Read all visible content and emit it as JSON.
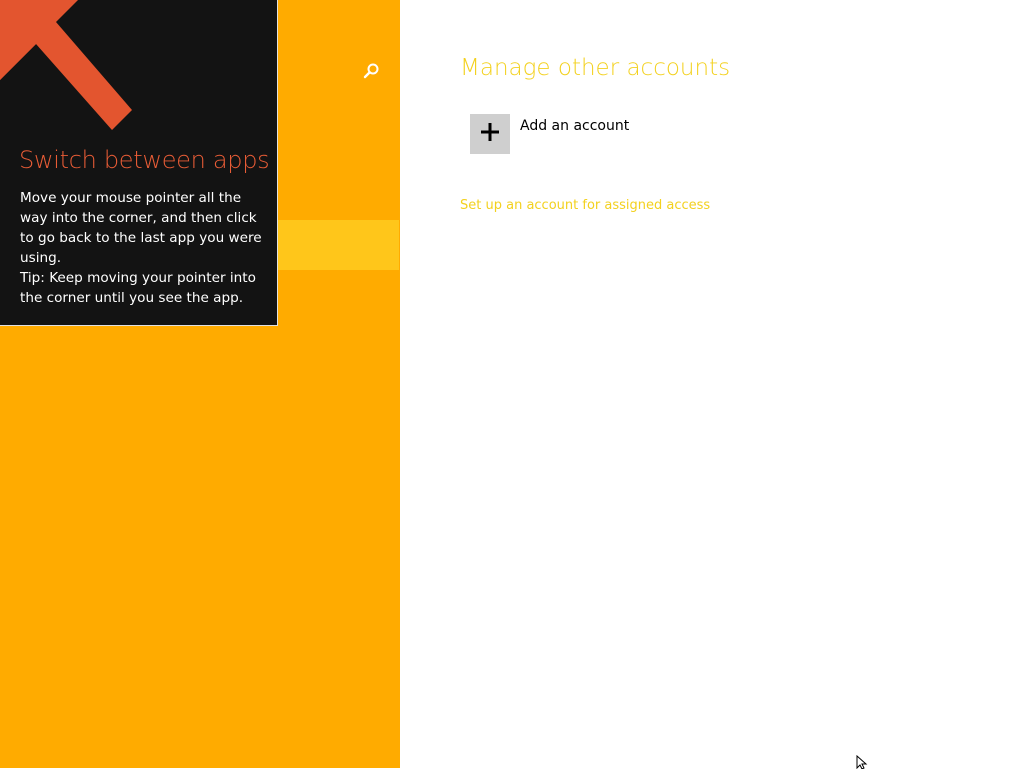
{
  "sidebar": {
    "search_icon": "search-icon",
    "background_color": "#ffab00",
    "selected_row_color": "#ffc61a"
  },
  "tip": {
    "title": "Switch between apps",
    "body_line": "Move your mouse pointer all the way into the corner, and then click to go back to the last app you were using.",
    "tip_line": "Tip: Keep moving your pointer into the corner until you see the app.",
    "arrow_icon": "arrow-up-left-icon",
    "title_color": "#e85c36",
    "background_color": "#131313"
  },
  "main": {
    "section_title": "Manage other accounts",
    "add_account_label": "Add an account",
    "add_icon": "plus-icon",
    "assigned_access_link": "Set up an account for assigned access",
    "accent_color": "#f3d11f"
  },
  "cursor": {
    "icon": "mouse-pointer-icon"
  }
}
